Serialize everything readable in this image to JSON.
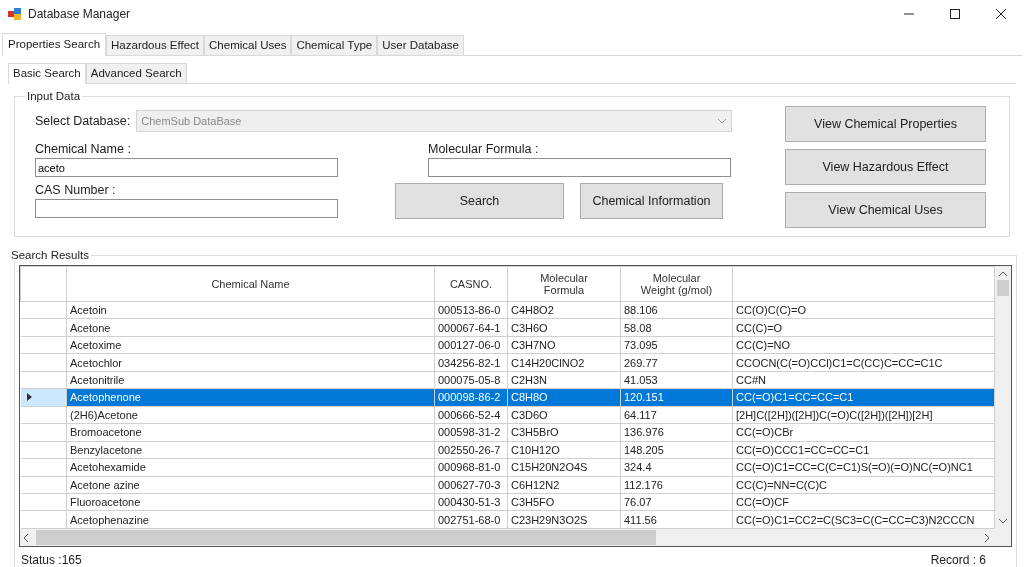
{
  "window": {
    "title": "Database Manager"
  },
  "tabs": [
    {
      "label": "Properties Search",
      "selected": true
    },
    {
      "label": "Hazardous Effect",
      "selected": false
    },
    {
      "label": "Chemical Uses",
      "selected": false
    },
    {
      "label": "Chemical Type",
      "selected": false
    },
    {
      "label": "User Database",
      "selected": false
    }
  ],
  "subtabs": [
    {
      "label": "Basic Search",
      "selected": true
    },
    {
      "label": "Advanced Search",
      "selected": false
    }
  ],
  "input_data": {
    "title": "Input Data",
    "select_label": "Select Database:",
    "database": {
      "value": "ChemSub DataBase",
      "disabled": true
    },
    "chemical_name_label": "Chemical Name :",
    "chemical_name_value": "aceto",
    "cas_label": "CAS Number :",
    "formula_label": "Molecular Formula :",
    "search_button": "Search",
    "info_button": "Chemical Information",
    "side_buttons": [
      "View Chemical Properties",
      "View Hazardous Effect",
      "View Chemical Uses"
    ]
  },
  "results": {
    "title": "Search Results",
    "columns": [
      "Chemical Name",
      "CASNO.",
      "Molecular Formula",
      "Molecular Weight (g/mol)"
    ],
    "rows": [
      {
        "cells": [
          "Acetoin",
          "000513-86-0",
          "C4H8O2",
          "88.106",
          "CC(O)C(C)=O"
        ],
        "selected": false
      },
      {
        "cells": [
          "Acetone",
          "000067-64-1",
          "C3H6O",
          "58.08",
          "CC(C)=O"
        ],
        "selected": false
      },
      {
        "cells": [
          "Acetoxime",
          "000127-06-0",
          "C3H7NO",
          "73.095",
          "CC(C)=NO"
        ],
        "selected": false
      },
      {
        "cells": [
          "Acetochlor",
          "034256-82-1",
          "C14H20ClNO2",
          "269.77",
          "CCOCN(C(=O)CCl)C1=C(CC)C=CC=C1C"
        ],
        "selected": false
      },
      {
        "cells": [
          "Acetonitrile",
          "000075-05-8",
          "C2H3N",
          "41.053",
          "CC#N"
        ],
        "selected": false
      },
      {
        "cells": [
          "Acetophenone",
          "000098-86-2",
          "C8H8O",
          "120.151",
          "CC(=O)C1=CC=CC=C1"
        ],
        "selected": true
      },
      {
        "cells": [
          "(2H6)Acetone",
          "000666-52-4",
          "C3D6O",
          "64.117",
          "[2H]C([2H])([2H])C(=O)C([2H])([2H])[2H]"
        ],
        "selected": false
      },
      {
        "cells": [
          "Bromoacetone",
          "000598-31-2",
          "C3H5BrO",
          "136.976",
          "CC(=O)CBr"
        ],
        "selected": false
      },
      {
        "cells": [
          "Benzylacetone",
          "002550-26-7",
          "C10H12O",
          "148.205",
          "CC(=O)CCC1=CC=CC=C1"
        ],
        "selected": false
      },
      {
        "cells": [
          "Acetohexamide",
          "000968-81-0",
          "C15H20N2O4S",
          "324.4",
          "CC(=O)C1=CC=C(C=C1)S(=O)(=O)NC(=O)NC1"
        ],
        "selected": false
      },
      {
        "cells": [
          "Acetone azine",
          "000627-70-3",
          "C6H12N2",
          "112.176",
          "CC(C)=NN=C(C)C"
        ],
        "selected": false
      },
      {
        "cells": [
          "Fluoroacetone",
          "000430-51-3",
          "C3H5FO",
          "76.07",
          "CC(=O)CF"
        ],
        "selected": false
      },
      {
        "cells": [
          "Acetophenazine",
          "002751-68-0",
          "C23H29N3O2S",
          "411.56",
          "CC(=O)C1=CC2=C(SC3=C(C=CC=C3)N2CCCN"
        ],
        "selected": false
      }
    ],
    "status": "Status :165",
    "record": "Record : 6"
  }
}
